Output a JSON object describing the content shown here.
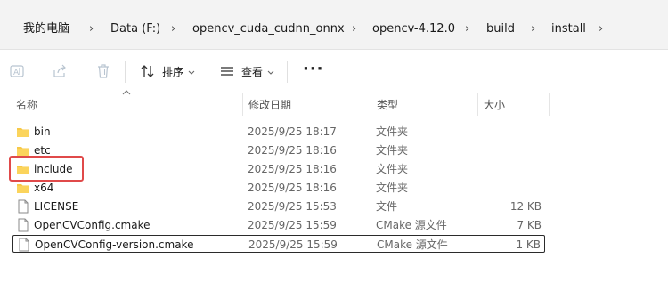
{
  "breadcrumb": {
    "items": [
      "我的电脑",
      "Data (F:)",
      "opencv_cuda_cudnn_onnx",
      "opencv-4.12.0",
      "build",
      "install"
    ],
    "separator": "›"
  },
  "toolbar": {
    "sort_label": "排序",
    "view_label": "查看",
    "more_label": "···"
  },
  "columns": {
    "name": "名称",
    "date": "修改日期",
    "type": "类型",
    "size": "大小"
  },
  "files": [
    {
      "name": "bin",
      "date": "2025/9/25 18:17",
      "type": "文件夹",
      "size": "",
      "icon": "folder-icon"
    },
    {
      "name": "etc",
      "date": "2025/9/25 18:16",
      "type": "文件夹",
      "size": "",
      "icon": "folder-icon"
    },
    {
      "name": "include",
      "date": "2025/9/25 18:16",
      "type": "文件夹",
      "size": "",
      "icon": "folder-icon"
    },
    {
      "name": "x64",
      "date": "2025/9/25 18:16",
      "type": "文件夹",
      "size": "",
      "icon": "folder-icon"
    },
    {
      "name": "LICENSE",
      "date": "2025/9/25 15:53",
      "type": "文件",
      "size": "12 KB",
      "icon": "file-icon"
    },
    {
      "name": "OpenCVConfig.cmake",
      "date": "2025/9/25 15:59",
      "type": "CMake 源文件",
      "size": "7 KB",
      "icon": "file-icon"
    },
    {
      "name": "OpenCVConfig-version.cmake",
      "date": "2025/9/25 15:59",
      "type": "CMake 源文件",
      "size": "1 KB",
      "icon": "file-icon"
    }
  ],
  "colors": {
    "folder": "#f7c948",
    "highlight": "#e04a4a",
    "focus_border": "#2b2b2b"
  }
}
